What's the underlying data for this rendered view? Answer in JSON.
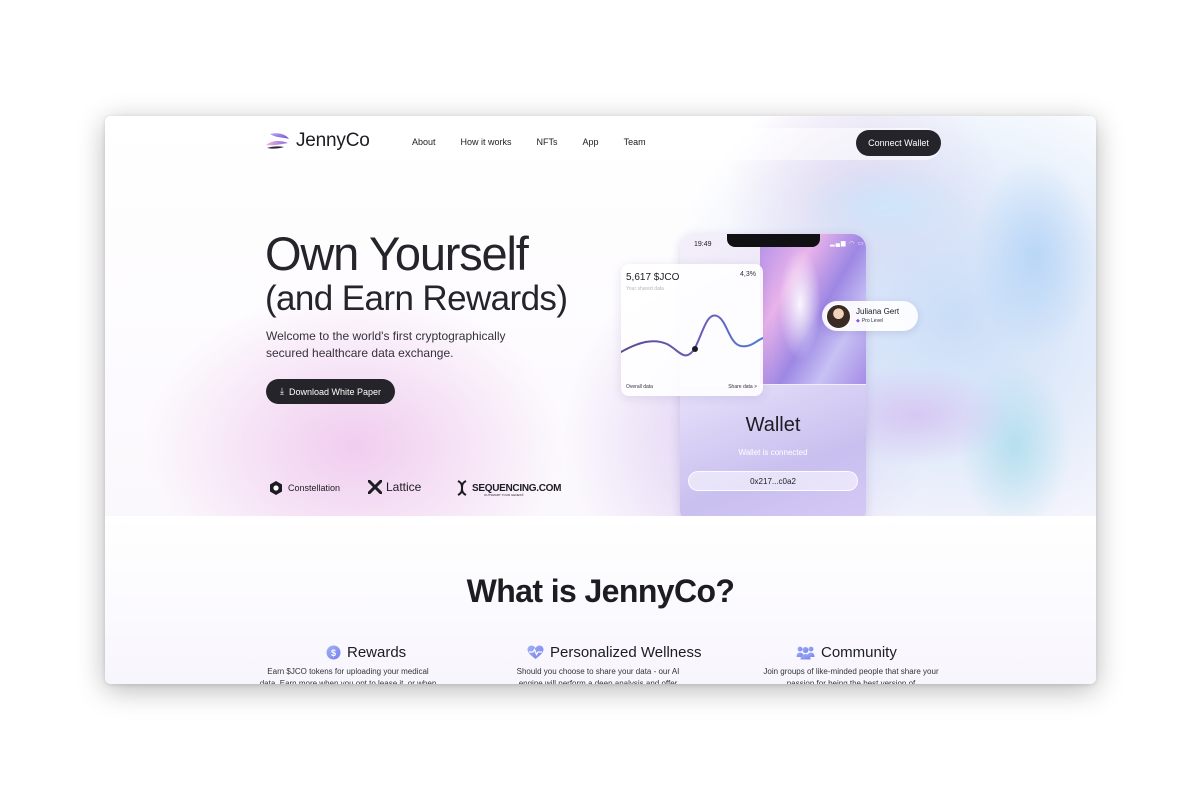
{
  "brand": {
    "name": "JennyCo"
  },
  "nav": {
    "links": [
      "About",
      "How it works",
      "NFTs",
      "App",
      "Team"
    ],
    "connect_label": "Connect Wallet"
  },
  "hero": {
    "title_line1": "Own Yourself",
    "title_line2": "(and Earn Rewards)",
    "subtitle": "Welcome to the world's first cryptographically secured healthcare data exchange.",
    "download_label": "Download White Paper"
  },
  "partners": {
    "constellation": "Constellation",
    "lattice": "Lattice",
    "sequencing": "SEQUENCING.COM",
    "sequencing_tagline": "OUTSMART YOUR GENES®"
  },
  "phone": {
    "time": "19:49",
    "status_icons": "▂▄▆ ◠ ▭",
    "wallet_title": "Wallet",
    "wallet_status": "Wallet is connected",
    "wallet_address": "0x217...c0a2"
  },
  "card": {
    "amount": "5,617 $JCO",
    "change": "4,3%",
    "subtitle": "Your shared data",
    "footer_left": "Overall data",
    "footer_right": "Share data >"
  },
  "profile": {
    "name": "Juliana Gert",
    "level": "Pro Level"
  },
  "section": {
    "title": "What is JennyCo?",
    "features": [
      {
        "icon": "dollar-coin-icon",
        "title": "Rewards",
        "desc": "Earn $JCO tokens for uploading your medical data. Earn more when you opt to lease it, or when you refer people."
      },
      {
        "icon": "heart-pulse-icon",
        "title": "Personalized Wellness",
        "desc": "Should you choose to share your data - our AI engine will perform a deep analysis and offer insights designed to"
      },
      {
        "icon": "people-icon",
        "title": "Community",
        "desc": "Join groups of like-minded people that share your passion for being the best version of"
      }
    ]
  },
  "colors": {
    "dark_button": "#25242a",
    "accent_purple": "#8a55e6",
    "chart_line_start": "#5d4a8e",
    "chart_line_end": "#4e7fd6"
  }
}
